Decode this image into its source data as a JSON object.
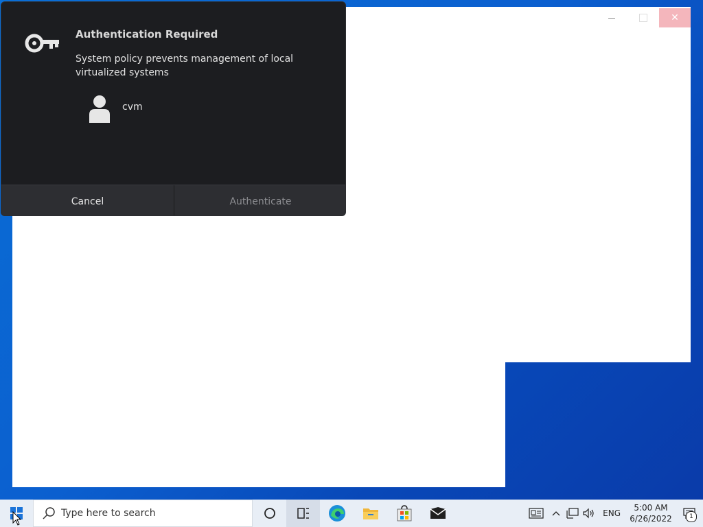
{
  "dialog": {
    "title": "Authentication Required",
    "message": "System policy prevents management of local virtualized systems",
    "user": "cvm",
    "cancel_label": "Cancel",
    "authenticate_label": "Authenticate",
    "icon": "key-icon",
    "user_icon": "user-icon"
  },
  "window_controls": {
    "close_glyph": "✕"
  },
  "taskbar": {
    "search_placeholder": "Type here to search",
    "language": "ENG",
    "time": "5:00 AM",
    "date": "6/26/2022",
    "notification_count": "1",
    "pinned": [
      "cortana-icon",
      "task-view-icon",
      "edge-icon",
      "file-explorer-icon",
      "store-icon",
      "mail-icon"
    ]
  },
  "colors": {
    "dialog_bg": "#1c1d20",
    "button_bg": "#2d2e32",
    "desktop_accent": "#0a6fd6",
    "close_hover": "#f4b6bc"
  }
}
